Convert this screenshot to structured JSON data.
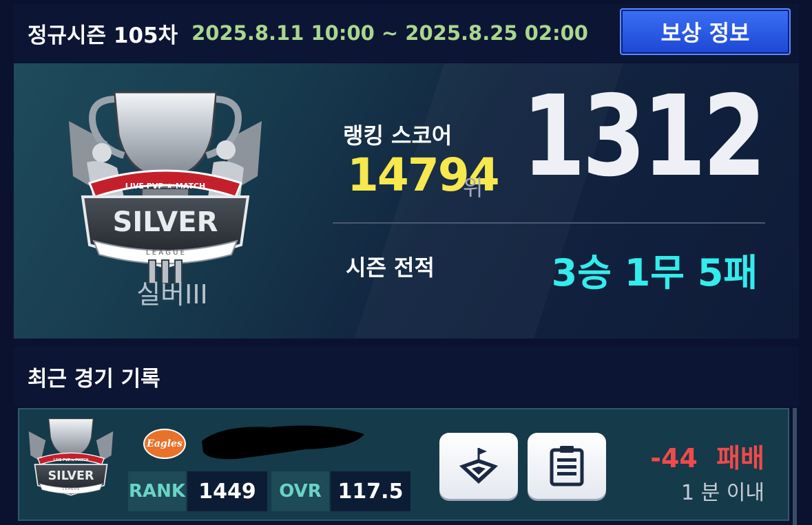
{
  "header": {
    "season_title": "정규시즌 105차",
    "season_dates": "2025.8.11 10:00 ~ 2025.8.25 02:00",
    "reward_button": "보상 정보"
  },
  "league": {
    "emblem_ribbon": "LIVE PVP ★ MATCH",
    "emblem_name": "SILVER",
    "emblem_sub": "L E A G U E",
    "tier_name": "실버III"
  },
  "ranking": {
    "label": "랭킹 스코어",
    "rank_value": "14794",
    "rank_unit": "위",
    "score": "1312"
  },
  "season_record": {
    "label": "시즌 전적",
    "value": "3승 1무 5패"
  },
  "recent": {
    "title": "최근 경기 기록",
    "matches": [
      {
        "team_logo_text": "Eagles",
        "rank_label": "RANK",
        "rank_value": "1449",
        "ovr_label": "OVR",
        "ovr_value": "117.5",
        "score_change": "-44",
        "result": "패배",
        "time": "1 분 이내"
      }
    ]
  },
  "colors": {
    "accent_button": "#2d5cf0",
    "rank_yellow": "#f7e84e",
    "record_cyan": "#33ecec",
    "date_green": "#a9d78e",
    "loss_red": "#f04a4a"
  },
  "icons": [
    "stadium-icon",
    "lineup-clipboard-icon"
  ]
}
